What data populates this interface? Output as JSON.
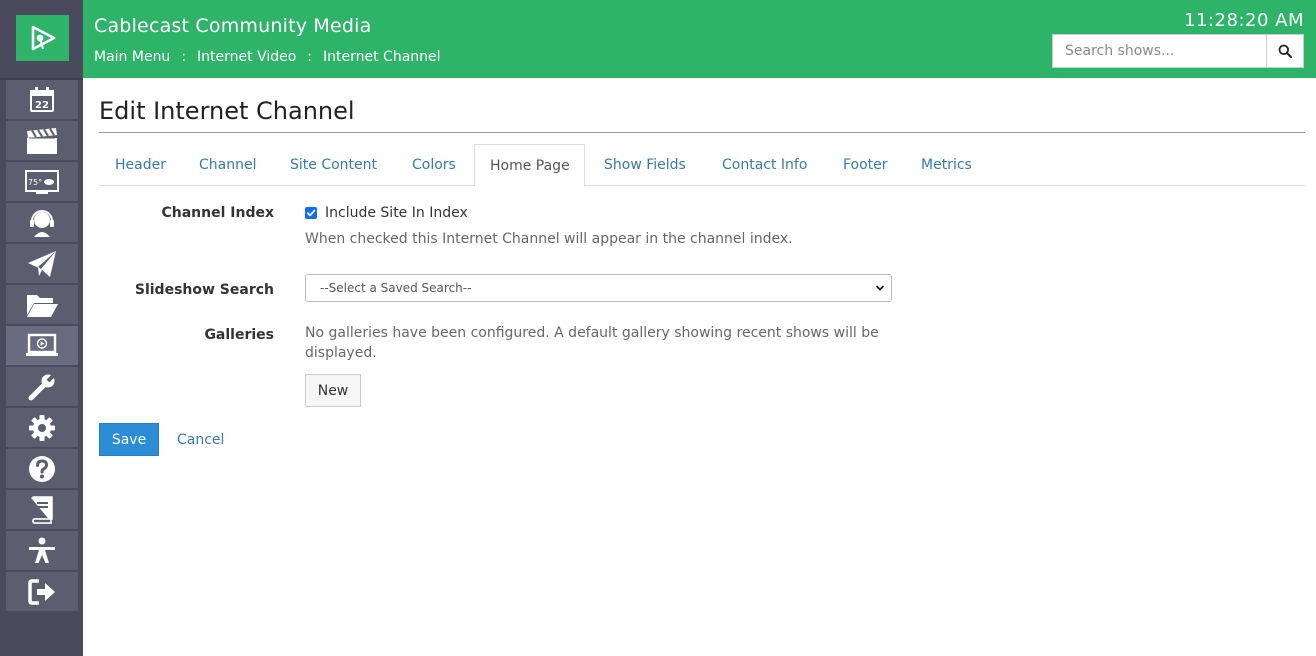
{
  "colors": {
    "accent": "#2db469",
    "sidebar": "#4a4a5c",
    "link": "#337ab7",
    "primary": "#2b8dd6"
  },
  "header": {
    "app_title": "Cablecast Community Media",
    "breadcrumb": [
      "Main Menu",
      "Internet Video",
      "Internet Channel"
    ],
    "breadcrumb_separator": ":",
    "clock": "11:28:20 AM",
    "search": {
      "placeholder": "Search shows...",
      "icon": "search-icon"
    }
  },
  "sidebar": {
    "logo_icon": "cablecast-play-logo",
    "items": [
      {
        "icon": "calendar-icon",
        "badge": "22"
      },
      {
        "icon": "clapperboard-icon"
      },
      {
        "icon": "weather-display-icon",
        "badge": "75°"
      },
      {
        "icon": "headset-icon"
      },
      {
        "icon": "paper-plane-icon"
      },
      {
        "icon": "folder-open-icon"
      },
      {
        "icon": "laptop-play-icon",
        "active": true
      },
      {
        "icon": "wrench-icon"
      },
      {
        "icon": "gear-icon"
      },
      {
        "icon": "question-icon"
      },
      {
        "icon": "book-icon"
      },
      {
        "icon": "person-icon"
      },
      {
        "icon": "sign-out-icon"
      }
    ]
  },
  "page": {
    "title": "Edit Internet Channel",
    "tabs": [
      {
        "label": "Header"
      },
      {
        "label": "Channel"
      },
      {
        "label": "Site Content"
      },
      {
        "label": "Colors"
      },
      {
        "label": "Home Page",
        "active": true
      },
      {
        "label": "Show Fields"
      },
      {
        "label": "Contact Info"
      },
      {
        "label": "Footer"
      },
      {
        "label": "Metrics"
      }
    ]
  },
  "form": {
    "channel_index": {
      "label": "Channel Index",
      "checkbox_label": "Include Site In Index",
      "checked": true,
      "help": "When checked this Internet Channel will appear in the channel index."
    },
    "slideshow_search": {
      "label": "Slideshow Search",
      "selected": "--Select a Saved Search--"
    },
    "galleries": {
      "label": "Galleries",
      "help_line1": "No galleries have been configured. A default gallery showing recent shows will be",
      "help_line2": "displayed.",
      "new_button": "New"
    }
  },
  "actions": {
    "save": "Save",
    "cancel": "Cancel"
  }
}
